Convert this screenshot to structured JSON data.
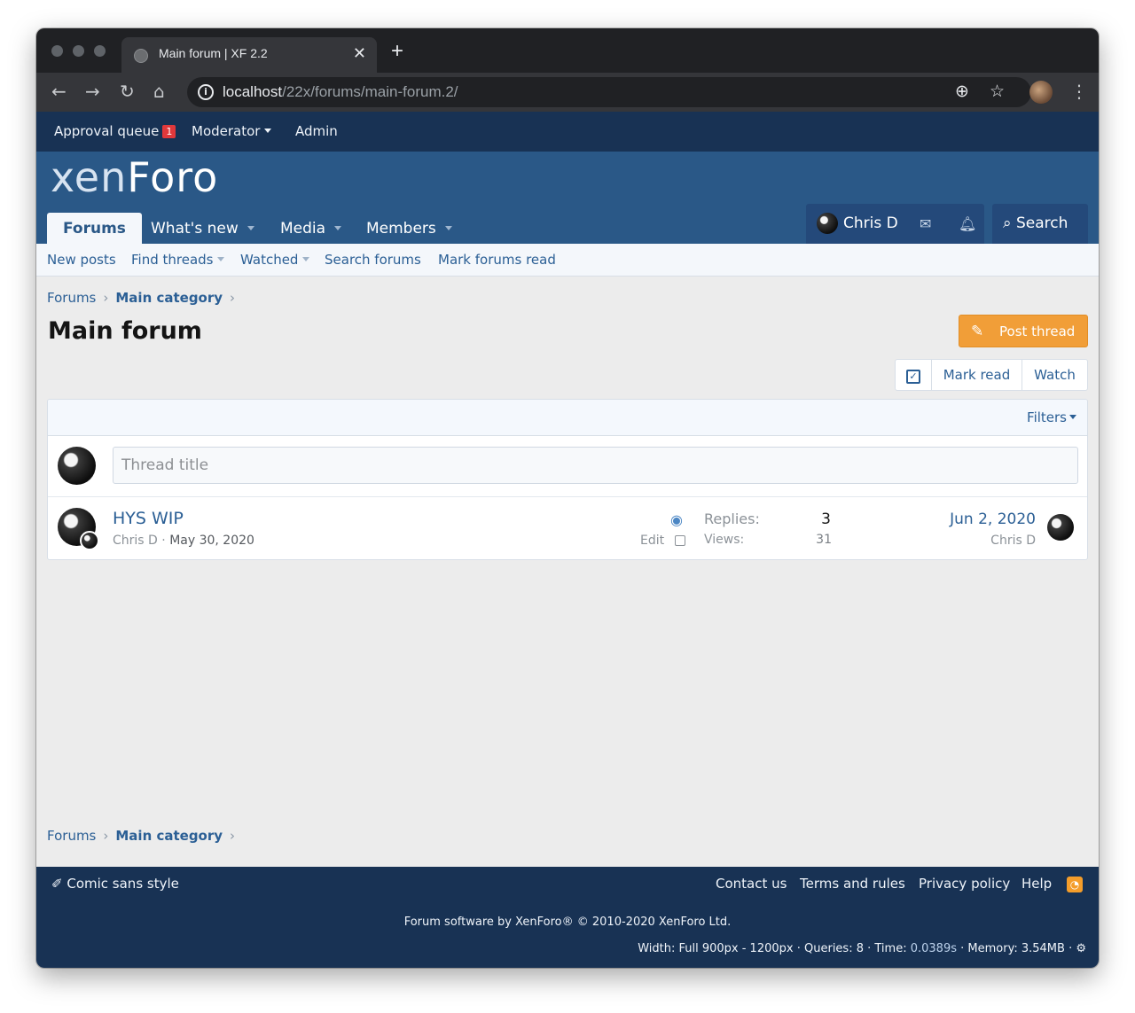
{
  "browser": {
    "tab_title": "Main forum | XF 2.2",
    "new_tab": "+",
    "tab_close": "✕",
    "url_host": "localhost",
    "url_path": "/22x/forums/main-forum.2/",
    "icons": [
      "back-icon",
      "forward-icon",
      "reload-icon",
      "home-icon",
      "info-icon",
      "add-page-icon",
      "star-icon",
      "profile-avatar",
      "menu-icon"
    ]
  },
  "staff_bar": {
    "approval_queue": "Approval queue",
    "approval_count": "1",
    "moderator": "Moderator",
    "admin": "Admin"
  },
  "header": {
    "logo_a": "xen",
    "logo_b": "Foro",
    "tabs": [
      {
        "label": "Forums"
      },
      {
        "label": "What's new"
      },
      {
        "label": "Media"
      },
      {
        "label": "Members"
      }
    ],
    "user": "Chris D",
    "search": "Search"
  },
  "sub_nav": {
    "items": [
      {
        "label": "New posts"
      },
      {
        "label": "Find threads"
      },
      {
        "label": "Watched"
      },
      {
        "label": "Search forums"
      },
      {
        "label": "Mark forums read"
      }
    ]
  },
  "breadcrumb": {
    "root": "Forums",
    "category": "Main category",
    "sep": "›"
  },
  "page": {
    "title": "Main forum",
    "post_thread": "Post thread",
    "mark_read": "Mark read",
    "watch": "Watch",
    "filters": "Filters",
    "thread_title_placeholder": "Thread title"
  },
  "threads": [
    {
      "title": "HYS WIP",
      "author": "Chris D",
      "dot": "·",
      "date": "May 30, 2020",
      "edit": "Edit",
      "replies_label": "Replies:",
      "replies": "3",
      "views_label": "Views:",
      "views": "31",
      "last_date": "Jun 2, 2020",
      "last_user": "Chris D"
    }
  ],
  "footer": {
    "style": "Comic sans style",
    "links": [
      {
        "label": "Contact us"
      },
      {
        "label": "Terms and rules"
      },
      {
        "label": "Privacy policy"
      },
      {
        "label": "Help"
      }
    ],
    "copyright": "Forum software by XenForo® © 2010-2020 XenForo Ltd.",
    "debug_width": "Width: Full 900px - 1200px",
    "debug_queries": "Queries: 8",
    "debug_time_label": "Time:",
    "debug_time": "0.0389s",
    "debug_memory": "Memory: 3.54MB"
  },
  "colors": {
    "staff_bar": "#183254",
    "header": "#2a5887",
    "link": "#2b5f95",
    "post_button": "#f19e38",
    "badge": "#e0383b"
  }
}
